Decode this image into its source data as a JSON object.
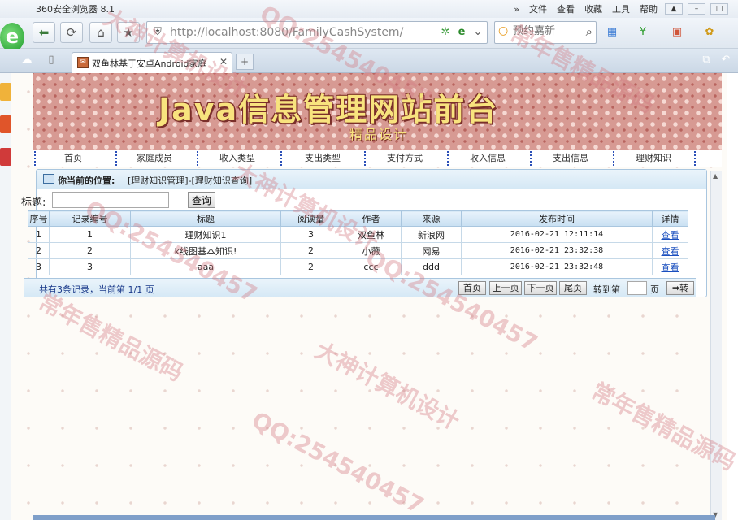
{
  "browser": {
    "app_title": "360安全浏览器 8.1",
    "menu": [
      "文件",
      "查看",
      "收藏",
      "工具",
      "帮助"
    ],
    "address": "http://localhost:8080/FamilyCashSystem/",
    "search_placeholder": "预约嘉新",
    "tab_title": "双鱼林基于安卓Android家庭",
    "tab_close": "✕",
    "new_tab": "+"
  },
  "banner": {
    "title": "Java信息管理网站前台",
    "subtitle": "精品设计"
  },
  "nav": [
    "首页",
    "家庭成员",
    "收入类型",
    "支出类型",
    "支付方式",
    "收入信息",
    "支出信息",
    "理财知识"
  ],
  "location": {
    "label": "你当前的位置:",
    "path": "[理财知识管理]-[理财知识查询]"
  },
  "search": {
    "label": "标题:",
    "value": "",
    "button": "查询"
  },
  "table": {
    "headers": [
      "序号",
      "记录编号",
      "标题",
      "阅读量",
      "作者",
      "来源",
      "发布时间",
      "详情"
    ],
    "rows": [
      [
        "1",
        "1",
        "理财知识1",
        "3",
        "双鱼林",
        "新浪网",
        "2016-02-21 12:11:14",
        "查看"
      ],
      [
        "2",
        "2",
        "k线图基本知识!",
        "2",
        "小薇",
        "网易",
        "2016-02-21 23:32:38",
        "查看"
      ],
      [
        "3",
        "3",
        "aaa",
        "2",
        "ccc",
        "ddd",
        "2016-02-21 23:32:48",
        "查看"
      ]
    ]
  },
  "pager": {
    "info": "共有3条记录，当前第 1/1 页",
    "first": "首页",
    "prev": "上一页",
    "next": "下一页",
    "last": "尾页",
    "goto_label": "转到第",
    "page_unit": "页",
    "goto_value": "",
    "go_button": "➡转"
  },
  "watermarks": [
    "大神计算机设计",
    "QQ:254540457",
    "常年售精品源码",
    "大神计算机设计",
    "QQ:254540457",
    "常年售精品源码",
    "QQ:254540457",
    "大神计算机设计",
    "常年售精品源码",
    "QQ:254540457"
  ]
}
